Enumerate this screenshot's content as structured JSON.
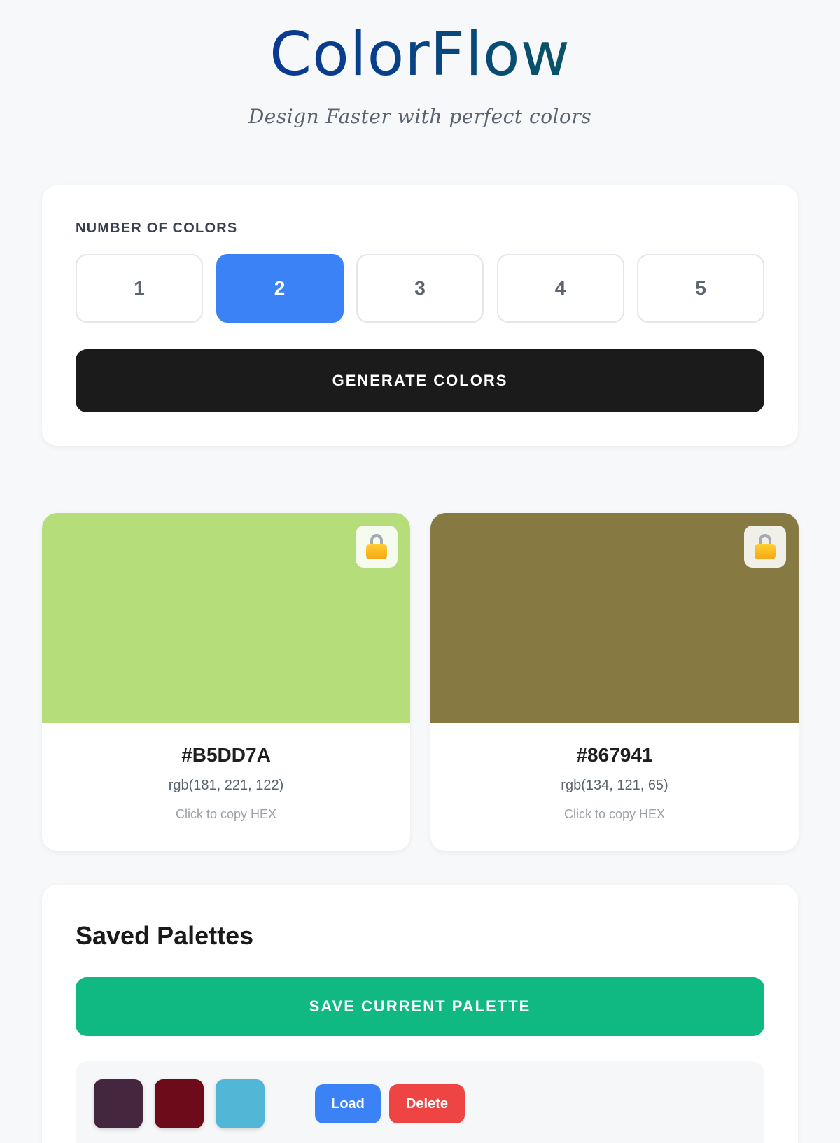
{
  "header": {
    "title": "ColorFlow",
    "tagline": "Design Faster with perfect colors"
  },
  "controls": {
    "label": "NUMBER OF COLORS",
    "counts": [
      "1",
      "2",
      "3",
      "4",
      "5"
    ],
    "selected": "2",
    "generate_label": "GENERATE COLORS"
  },
  "swatches": [
    {
      "color": "#B5DD7A",
      "hex": "#B5DD7A",
      "rgb": "rgb(181, 221, 122)",
      "copy_hint": "Click to copy HEX",
      "lock_icon": "lock-icon"
    },
    {
      "color": "#867941",
      "hex": "#867941",
      "rgb": "rgb(134, 121, 65)",
      "copy_hint": "Click to copy HEX",
      "lock_icon": "lock-icon"
    }
  ],
  "saved": {
    "title": "Saved Palettes",
    "save_label": "SAVE CURRENT PALETTE",
    "palettes": [
      {
        "colors": [
          "#45263F",
          "#6E0B1A",
          "#52B6D6"
        ],
        "load_label": "Load",
        "delete_label": "Delete"
      }
    ]
  },
  "colors": {
    "accent": "#3B82F6",
    "generate": "#1B1B1B",
    "save": "#10B981",
    "delete": "#EF4444"
  }
}
